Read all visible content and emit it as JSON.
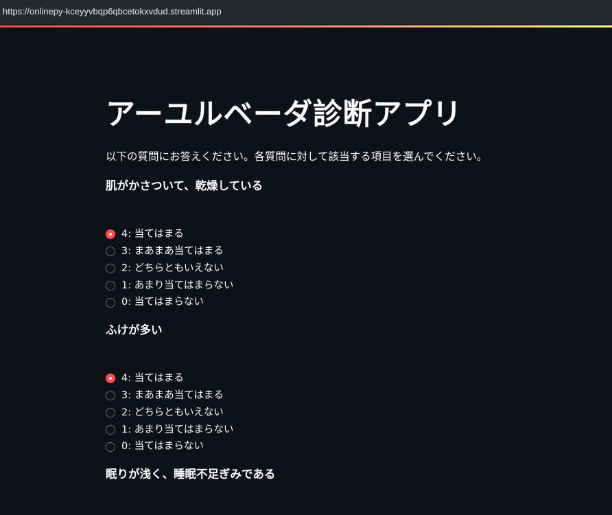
{
  "browser": {
    "url": "https://onlinepy-kceyyvbqp6qbcetokxvdud.streamlit.app"
  },
  "theme": {
    "background": "#0e1117",
    "accent": "#ff4b4b",
    "text": "#fafafa"
  },
  "page": {
    "title": "アーユルベーダ診断アプリ",
    "intro": "以下の質問にお答えください。各質問に対して該当する項目を選んでください。"
  },
  "questions": [
    {
      "text": "肌がかさついて、乾燥している",
      "options": [
        "4: 当てはまる",
        "3: まあまあ当てはまる",
        "2: どちらともいえない",
        "1: あまり当てはまらない",
        "0: 当てはまらない"
      ],
      "selected_index": 0
    },
    {
      "text": "ふけが多い",
      "options": [
        "4: 当てはまる",
        "3: まあまあ当てはまる",
        "2: どちらともいえない",
        "1: あまり当てはまらない",
        "0: 当てはまらない"
      ],
      "selected_index": 0
    },
    {
      "text": "眠りが浅く、睡眠不足ぎみである"
    }
  ]
}
